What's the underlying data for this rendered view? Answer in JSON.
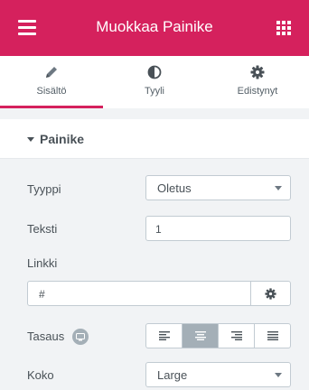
{
  "header": {
    "title": "Muokkaa Painike",
    "menu_icon": "hamburger-menu-icon",
    "widgets_icon": "grid-icon",
    "color": "#d5215d"
  },
  "tabs": [
    {
      "label": "Sisältö",
      "icon": "pencil-icon",
      "active": true
    },
    {
      "label": "Tyyli",
      "icon": "half-circle-icon",
      "active": false
    },
    {
      "label": "Edistynyt",
      "icon": "gear-icon",
      "active": false
    }
  ],
  "section": {
    "title": "Painike"
  },
  "controls": {
    "type": {
      "label": "Tyyppi",
      "value": "Oletus"
    },
    "text": {
      "label": "Teksti",
      "value": "1"
    },
    "link": {
      "label": "Linkki",
      "value": "#"
    },
    "alignment": {
      "label": "Tasaus",
      "options": [
        "align-left-icon",
        "align-center-icon",
        "align-right-icon",
        "align-justify-icon"
      ],
      "selected": "align-center-icon"
    },
    "size": {
      "label": "Koko",
      "value": "Large"
    }
  }
}
